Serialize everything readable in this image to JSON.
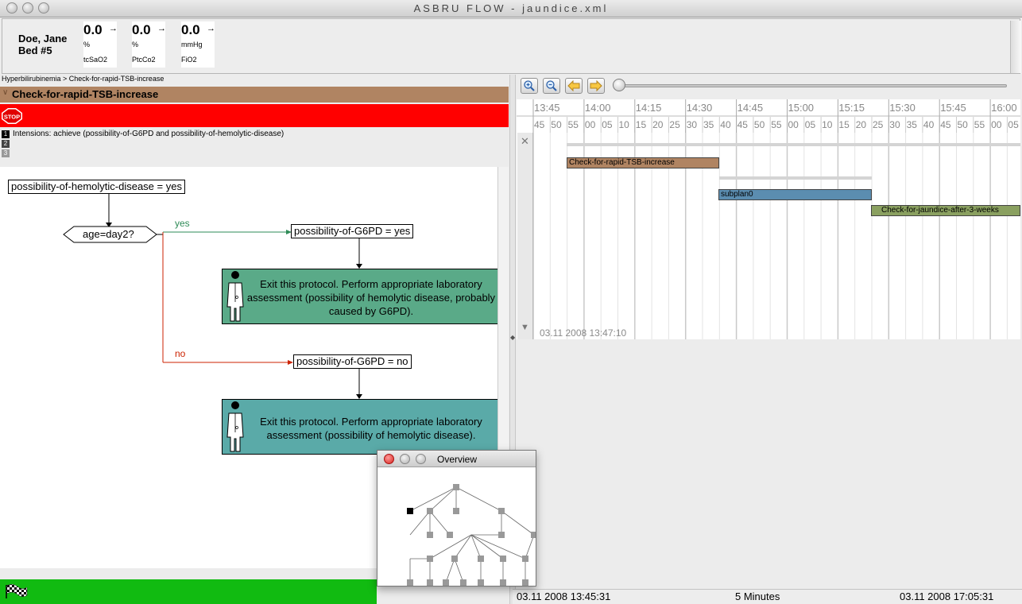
{
  "window": {
    "title": "ASBRU FLOW - jaundice.xml"
  },
  "patient": {
    "name": "Doe, Jane",
    "bed": "Bed #5",
    "vitals": [
      {
        "value": "0.0",
        "trend": "→",
        "unit": "%",
        "name": "tcSaO2"
      },
      {
        "value": "0.0",
        "trend": "→",
        "unit": "%",
        "name": "PtcCo2"
      },
      {
        "value": "0.0",
        "trend": "→",
        "unit": "mmHg",
        "name": "FiO2"
      }
    ]
  },
  "breadcrumb": "Hyperbilirubinemia > Check-for-rapid-TSB-increase",
  "plan": {
    "title": "Check-for-rapid-TSB-increase",
    "stop_label": "STOP",
    "intentions": "Intensions: achieve (possibility-of-G6PD and possibility-of-hemolytic-disease)",
    "badges": [
      "1",
      "2",
      "3"
    ]
  },
  "flow": {
    "start_condition": "possibility-of-hemolytic-disease = yes",
    "decision": "age=day2?",
    "yes_label": "yes",
    "no_label": "no",
    "yes_condition": "possibility-of-G6PD = yes",
    "no_condition": "possibility-of-G6PD = no",
    "yes_action": "Exit this protocol. Perform appropriate laboratory assessment (possibility of hemolytic disease, probably caused by G6PD).",
    "no_action": "Exit this protocol. Perform appropriate laboratory assessment (possibility of hemolytic disease).",
    "yes_action_color": "#5aaa88",
    "no_action_color": "#5aaaa8"
  },
  "toolbar": {
    "zoom_in_icon": "zoom-in-icon",
    "zoom_out_icon": "zoom-out-icon",
    "back_icon": "arrow-left-icon",
    "forward_icon": "arrow-right-icon"
  },
  "timeline": {
    "hours": [
      "13:45",
      "14:00",
      "14:15",
      "14:30",
      "14:45",
      "15:00",
      "15:15",
      "15:30",
      "15:45",
      "16:00"
    ],
    "minutes": [
      "45",
      "50",
      "55",
      "00",
      "05",
      "10",
      "15",
      "20",
      "25",
      "30",
      "35",
      "40",
      "45",
      "50",
      "55",
      "00",
      "05",
      "10",
      "15",
      "20",
      "25",
      "30",
      "35",
      "40",
      "45",
      "50",
      "55",
      "00",
      "05"
    ],
    "timestamp": "03.11 2008 13:47:10",
    "bars": [
      {
        "label": "Check-for-rapid-TSB-increase",
        "color": "#b08462"
      },
      {
        "label": "subplan0",
        "color": "#5b8db0"
      },
      {
        "label": "Check-for-jaundice-after-3-weeks",
        "color": "#8aa060"
      }
    ]
  },
  "status": {
    "start": "03.11 2008 13:45:31",
    "scale": "5 Minutes",
    "end": "03.11 2008 17:05:31"
  },
  "overview": {
    "title": "Overview"
  }
}
